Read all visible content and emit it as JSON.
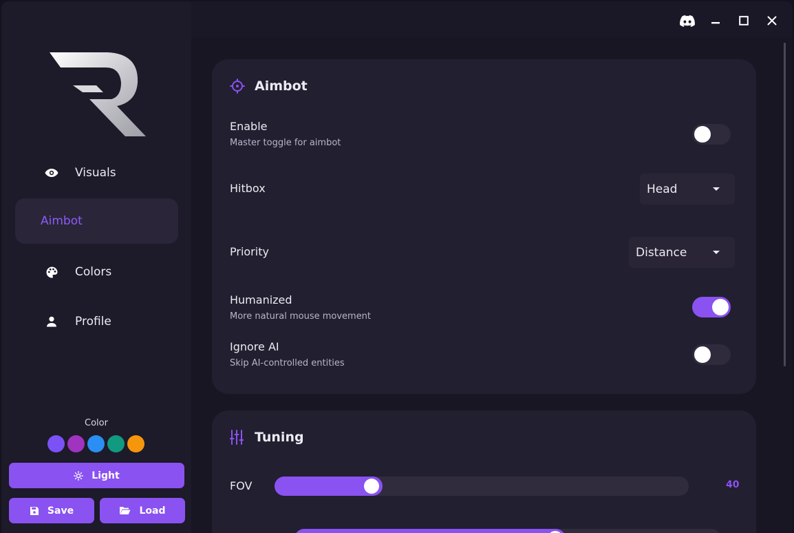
{
  "sidebar": {
    "nav": [
      {
        "label": "Visuals",
        "icon": "eye-icon",
        "active": false
      },
      {
        "label": "Aimbot",
        "icon": "",
        "active": true
      },
      {
        "label": "Colors",
        "icon": "palette-icon",
        "active": false
      },
      {
        "label": "Profile",
        "icon": "person-icon",
        "active": false
      }
    ],
    "color_label": "Color",
    "swatches": [
      "#7b52f6",
      "#a033c0",
      "#2a8ef2",
      "#119a80",
      "#f5960d"
    ],
    "theme_button": "Light",
    "save_button": "Save",
    "load_button": "Load"
  },
  "aimbot": {
    "title": "Aimbot",
    "enable": {
      "label": "Enable",
      "sub": "Master toggle for aimbot",
      "on": false
    },
    "hitbox": {
      "label": "Hitbox",
      "value": "Head"
    },
    "priority": {
      "label": "Priority",
      "value": "Distance"
    },
    "humanized": {
      "label": "Humanized",
      "sub": "More natural mouse movement",
      "on": true
    },
    "ignore_ai": {
      "label": "Ignore AI",
      "sub": "Skip AI-controlled entities",
      "on": false
    }
  },
  "tuning": {
    "title": "Tuning",
    "fov": {
      "label": "FOV",
      "value": "40"
    }
  },
  "colors": {
    "accent": "#8a52f0"
  }
}
